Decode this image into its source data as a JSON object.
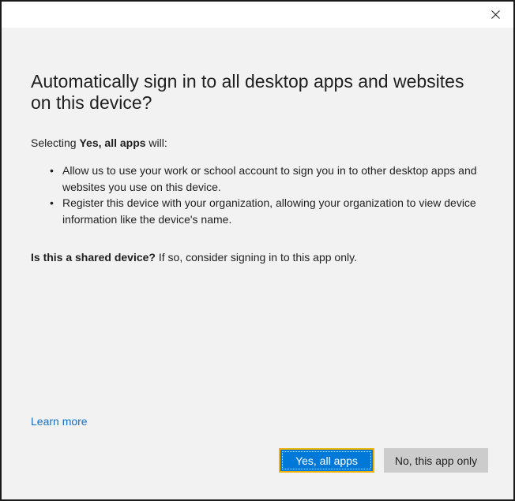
{
  "window": {
    "close_icon": "close-icon"
  },
  "heading": "Automatically sign in to all desktop apps and websites on this device?",
  "intro": {
    "prefix": "Selecting ",
    "bold": "Yes, all apps",
    "suffix": " will:"
  },
  "bullets": [
    "Allow us to use your work or school account to sign you in to other desktop apps and websites you use on this device.",
    "Register this device with your organization, allowing your organization to view device information like the device's name."
  ],
  "shared": {
    "bold": "Is this a shared device?",
    "rest": " If so, consider signing in to this app only."
  },
  "learn_more": "Learn more",
  "buttons": {
    "primary": "Yes, all apps",
    "secondary": "No, this app only"
  },
  "colors": {
    "accent": "#0078d7",
    "focus_border": "#f0b400",
    "link": "#1a6fc0",
    "background": "#f2f2f2",
    "secondary_button": "#cccccc"
  }
}
